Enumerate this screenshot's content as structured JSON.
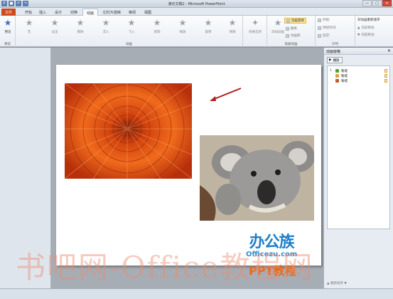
{
  "window": {
    "title": "演示文稿2 - Microsoft PowerPoint",
    "controls": [
      "—",
      "□",
      "✕"
    ]
  },
  "tabs": [
    "文件",
    "开始",
    "插入",
    "设计",
    "切换",
    "动画",
    "幻灯片放映",
    "审阅",
    "视图"
  ],
  "active_tab": "动画",
  "ribbon": {
    "preview": "预览",
    "preview_group": "预览",
    "animations": [
      "无",
      "淡出",
      "擦除",
      "浮入",
      "飞入",
      "劈裂",
      "缩放",
      "旋转",
      "弹跳"
    ],
    "animation_group": "动画",
    "effect_options": "效果选项",
    "add_animation": "添加动画",
    "animation_pane_btn": "动画窗格",
    "trigger_btn": "触发",
    "painter_btn": "动画刷",
    "advanced_group": "高级动画",
    "start": "开始:",
    "duration": "持续时间:",
    "delay": "延迟:",
    "timing_group": "计时",
    "reorder_title": "对动画重新排序",
    "move_earlier": "向前移动",
    "move_later": "向后移动"
  },
  "animation_pane": {
    "title": "动画窗格",
    "play": "播放",
    "items": [
      {
        "num": "1",
        "label": "勒戒"
      },
      {
        "num": "",
        "label": "勒戒"
      },
      {
        "num": "",
        "label": "勒戒"
      }
    ],
    "reorder": "重新排序"
  },
  "watermark": {
    "logo": "办公族",
    "domain": "Officezu.com",
    "ppt": "PPT教程",
    "site": "书吧网-Office教程网"
  },
  "colors": {
    "file_tab": "#cc4a1b",
    "logo_blue": "#1e7fc8",
    "ppt_orange": "#e76a18"
  }
}
